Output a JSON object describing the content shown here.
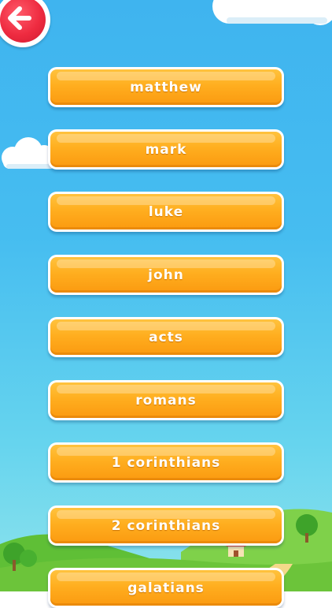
{
  "header": {
    "back_icon": "arrow-left-icon"
  },
  "books": [
    {
      "label": "MATTHEW"
    },
    {
      "label": "MARK"
    },
    {
      "label": "LUKE"
    },
    {
      "label": "JOHN"
    },
    {
      "label": "ACTS"
    },
    {
      "label": "ROMANS"
    },
    {
      "label": "1 CORINTHIANS"
    },
    {
      "label": "2 CORINTHIANS"
    },
    {
      "label": "GALATIANS"
    }
  ],
  "colors": {
    "sky_top": "#3fb4ef",
    "sky_bottom": "#8ee3ec",
    "button_orange": "#ffae1f",
    "button_border": "#ffffff",
    "back_button_red": "#ee2b40",
    "label_text": "#ffffff",
    "grass": "#6cc43a"
  }
}
